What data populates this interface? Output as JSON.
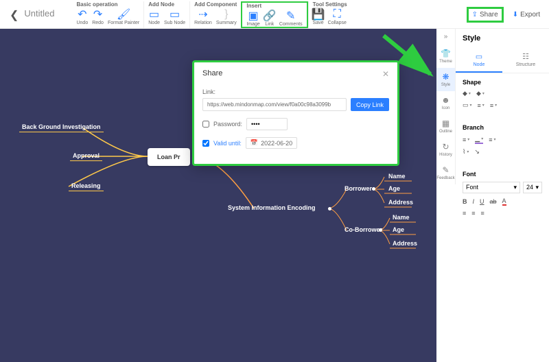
{
  "header": {
    "title": "Untitled",
    "groups": [
      {
        "title": "Basic operation",
        "items": [
          {
            "name": "undo",
            "label": "Undo",
            "icon": "↶"
          },
          {
            "name": "redo",
            "label": "Redo",
            "icon": "↷"
          },
          {
            "name": "format-painter",
            "label": "Format Painter",
            "icon": "🖌"
          }
        ]
      },
      {
        "title": "Add Node",
        "items": [
          {
            "name": "node",
            "label": "Node",
            "icon": "▭"
          },
          {
            "name": "sub-node",
            "label": "Sub Node",
            "icon": "▭"
          }
        ]
      },
      {
        "title": "Add Component",
        "items": [
          {
            "name": "relation",
            "label": "Relation",
            "icon": "⇢"
          },
          {
            "name": "summary",
            "label": "Summary",
            "icon": "}",
            "disabled": true
          }
        ]
      },
      {
        "title": "Insert",
        "highlight": true,
        "items": [
          {
            "name": "image",
            "label": "Image",
            "icon": "▣"
          },
          {
            "name": "link",
            "label": "Link",
            "icon": "🔗"
          },
          {
            "name": "comments",
            "label": "Comments",
            "icon": "✎"
          }
        ]
      },
      {
        "title": "Tool Settings",
        "items": [
          {
            "name": "save",
            "label": "Save",
            "icon": "💾"
          },
          {
            "name": "collapse",
            "label": "Collapse",
            "icon": "⛶"
          }
        ]
      }
    ],
    "share": "Share",
    "export": "Export"
  },
  "canvas": {
    "root": "Loan Pr",
    "left_nodes": [
      "Back Ground Investigation",
      "Approval",
      "Releasing"
    ],
    "right": {
      "label": "System Information Encoding",
      "children": [
        {
          "label": "Borrower",
          "children": [
            "Name",
            "Age",
            "Address"
          ]
        },
        {
          "label": "Co-Borrower",
          "children": [
            "Name",
            "Age",
            "Address"
          ]
        }
      ]
    }
  },
  "sidebar": {
    "items": [
      {
        "name": "theme",
        "label": "Theme",
        "icon": "👕"
      },
      {
        "name": "style",
        "label": "Style",
        "icon": "❋",
        "active": true
      },
      {
        "name": "icon",
        "label": "Icon",
        "icon": "☻"
      },
      {
        "name": "outline",
        "label": "Outline",
        "icon": "▦"
      },
      {
        "name": "history",
        "label": "History",
        "icon": "↻"
      },
      {
        "name": "feedback",
        "label": "Feedback",
        "icon": "✎"
      }
    ]
  },
  "rpanel": {
    "title": "Style",
    "tabs": [
      {
        "name": "node",
        "label": "Node",
        "icon": "▭",
        "active": true
      },
      {
        "name": "structure",
        "label": "Structure",
        "icon": "☷"
      }
    ],
    "sections": {
      "shape": "Shape",
      "branch": "Branch",
      "font": "Font"
    },
    "font_name": "Font",
    "font_size": "24"
  },
  "dialog": {
    "title": "Share",
    "link_label": "Link:",
    "link_value": "https://web.mindonmap.com/view/f0a00c98a3099b",
    "copy": "Copy Link",
    "password_label": "Password:",
    "password_value": "••••",
    "valid_label": "Valid until:",
    "valid_date": "2022-06-20"
  }
}
